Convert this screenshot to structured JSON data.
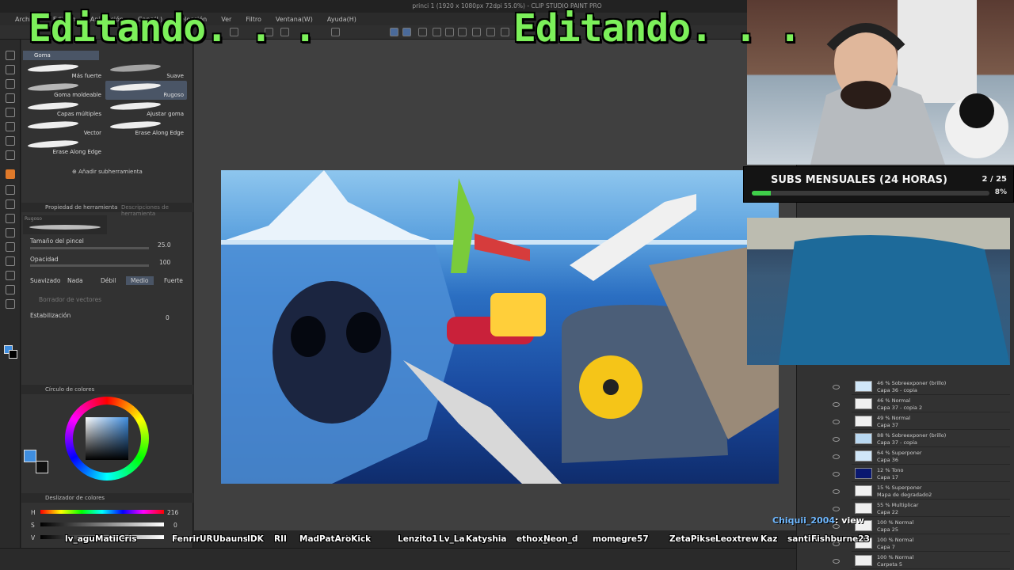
{
  "window": {
    "title": "princi 1 (1920 x 1080px 72dpi 55.0%) - CLIP STUDIO PAINT PRO"
  },
  "menu": [
    "Archivo",
    "Edición",
    "Animación",
    "Capa(L)",
    "Selección",
    "Ver",
    "Filtro",
    "Ventana(W)",
    "Ayuda(H)"
  ],
  "overlay": {
    "left_text": "Editando. . .",
    "right_text": "Editando. . ."
  },
  "subtool": {
    "active_tab": "Goma",
    "brushes": [
      {
        "label": "Más fuerte"
      },
      {
        "label": "Suave"
      },
      {
        "label": "Goma moldeable"
      },
      {
        "label": "Rugoso"
      },
      {
        "label": "Capas múltiples"
      },
      {
        "label": "Ajustar goma"
      },
      {
        "label": "Vector"
      },
      {
        "label": "Erase Along Edge"
      },
      {
        "label": "Erase Along Edge"
      }
    ],
    "add_label": "Añadir subherramienta"
  },
  "tool_property": {
    "tab_label": "Propiedad de herramienta",
    "tab2_label": "Descripciones de herramienta",
    "preview_label": "Rugoso",
    "brush_size_label": "Tamaño del pincel",
    "brush_size_value": "25.0",
    "opacity_label": "Opacidad",
    "opacity_value": "100",
    "smoothing_label": "Suavizado",
    "smoothing_options": [
      "Nada",
      "Débil",
      "Medio",
      "Fuerte"
    ],
    "smoothing_selected": "Medio",
    "vector_eraser_label": "Borrador de vectores",
    "stabilization_label": "Estabilización",
    "stabilization_value": "0"
  },
  "color_wheel": {
    "tab_label": "Círculo de colores",
    "main_color": "#3f8ee0"
  },
  "color_slider": {
    "tab_label": "Deslizador de colores",
    "h_label": "H",
    "h_value": "216",
    "s_label": "S",
    "s_value": "0",
    "v_label": "V",
    "v_value": "0"
  },
  "stream": {
    "subs_title": "SUBS MENSUALES (24 HORAS)",
    "subs_count": "2 / 25",
    "subs_percent": "8%",
    "subs_progress": 0.08
  },
  "chat": {
    "user": "Chiquii_2004",
    "message": ": view"
  },
  "viewers": [
    "lv_agu",
    "MatiiCris",
    "Fenrir",
    "URUbaunsub",
    "IDK",
    "RII",
    "MadPatArt",
    "oKick",
    "Lenzito1",
    "Lv_La",
    "Katyshia",
    "ethox_i",
    "Neon_d",
    "momegre57",
    "ZetaPiksel",
    "Leoxtrew",
    "Kaz",
    "santiro",
    "Fishburne23"
  ],
  "layers": [
    {
      "blend": "46 % Sobreexponer (brillo)",
      "name": "Capa 36 - copia"
    },
    {
      "blend": "46 % Normal",
      "name": "Capa 37 - copia 2"
    },
    {
      "blend": "49 % Normal",
      "name": "Capa 37"
    },
    {
      "blend": "88 % Sobreexponer (brillo)",
      "name": "Capa 37 - copia"
    },
    {
      "blend": "64 % Superponer",
      "name": "Capa 36"
    },
    {
      "blend": "12 % Tono",
      "name": "Capa 17"
    },
    {
      "blend": "15 % Superponer",
      "name": "Mapa de degradado2"
    },
    {
      "blend": "55 % Multiplicar",
      "name": "Capa 22"
    },
    {
      "blend": "100 % Normal",
      "name": "Capa 25"
    },
    {
      "blend": "100 % Normal",
      "name": "Capa 7"
    },
    {
      "blend": "100 % Normal",
      "name": "Carpeta 5"
    }
  ]
}
